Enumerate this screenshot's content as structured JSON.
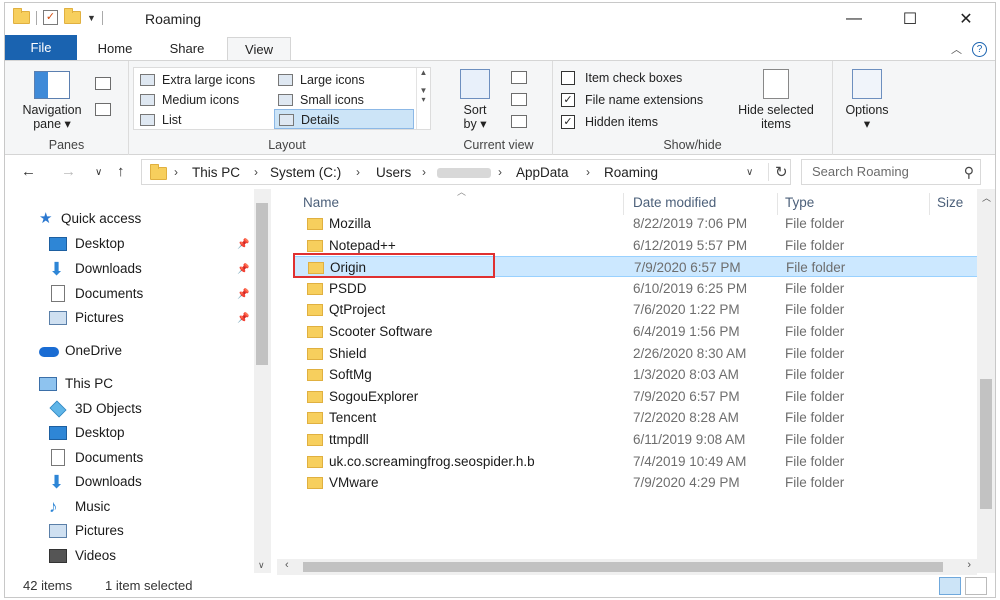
{
  "window": {
    "title": "Roaming",
    "minimize": "—",
    "maximize": "☐",
    "close": "✕"
  },
  "ribbon_tabs": [
    "File",
    "Home",
    "Share",
    "View"
  ],
  "ribbon": {
    "panes": {
      "navigation_pane_line1": "Navigation",
      "navigation_pane_line2": "pane ▾",
      "group_label": "Panes"
    },
    "layout": {
      "items": [
        "Extra large icons",
        "Large icons",
        "Medium icons",
        "Small icons",
        "List",
        "Details"
      ],
      "selected": "Details",
      "group_label": "Layout"
    },
    "current_view": {
      "sort_line1": "Sort",
      "sort_line2": "by ▾",
      "group_label": "Current view"
    },
    "show_hide": {
      "item_check_boxes": "Item check boxes",
      "item_check_boxes_checked": false,
      "file_name_extensions": "File name extensions",
      "file_name_extensions_checked": true,
      "hidden_items": "Hidden items",
      "hidden_items_checked": true,
      "hide_selected_line1": "Hide selected",
      "hide_selected_line2": "items",
      "group_label": "Show/hide"
    },
    "options_line1": "Options",
    "options_line2": "▾"
  },
  "address": {
    "crumbs": [
      "This PC",
      "System (C:)",
      "Users",
      "AppData",
      "Roaming"
    ],
    "search_placeholder": "Search Roaming"
  },
  "nav_pane": {
    "quick_access": "Quick access",
    "quick_items": [
      "Desktop",
      "Downloads",
      "Documents",
      "Pictures"
    ],
    "onedrive": "OneDrive",
    "this_pc": "This PC",
    "pc_items": [
      "3D Objects",
      "Desktop",
      "Documents",
      "Downloads",
      "Music",
      "Pictures",
      "Videos"
    ]
  },
  "columns": {
    "name": "Name",
    "date_modified": "Date modified",
    "type": "Type",
    "size": "Size"
  },
  "files": [
    {
      "name": "Mozilla",
      "date": "8/22/2019 7:06 PM",
      "type": "File folder"
    },
    {
      "name": "Notepad++",
      "date": "6/12/2019 5:57 PM",
      "type": "File folder"
    },
    {
      "name": "Origin",
      "date": "7/9/2020 6:57 PM",
      "type": "File folder"
    },
    {
      "name": "PSDD",
      "date": "6/10/2019 6:25 PM",
      "type": "File folder"
    },
    {
      "name": "QtProject",
      "date": "7/6/2020 1:22 PM",
      "type": "File folder"
    },
    {
      "name": "Scooter Software",
      "date": "6/4/2019 1:56 PM",
      "type": "File folder"
    },
    {
      "name": "Shield",
      "date": "2/26/2020 8:30 AM",
      "type": "File folder"
    },
    {
      "name": "SoftMg",
      "date": "1/3/2020 8:03 AM",
      "type": "File folder"
    },
    {
      "name": "SogouExplorer",
      "date": "7/9/2020 6:57 PM",
      "type": "File folder"
    },
    {
      "name": "Tencent",
      "date": "7/2/2020 8:28 AM",
      "type": "File folder"
    },
    {
      "name": "ttmpdll",
      "date": "6/11/2019 9:08 AM",
      "type": "File folder"
    },
    {
      "name": "uk.co.screamingfrog.seospider.h.b",
      "date": "7/4/2019 10:49 AM",
      "type": "File folder"
    },
    {
      "name": "VMware",
      "date": "7/9/2020 4:29 PM",
      "type": "File folder"
    }
  ],
  "selected_file_index": 2,
  "status": {
    "item_count": "42 items",
    "selection": "1 item selected"
  },
  "colors": {
    "accent": "#1a63b0",
    "selection_bg": "#cce8ff",
    "highlight_box": "#e03030",
    "folder": "#f7cf5d"
  }
}
